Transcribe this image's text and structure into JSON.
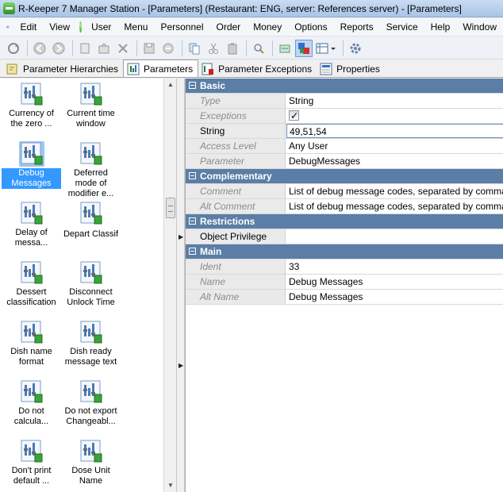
{
  "window": {
    "title": "R-Keeper 7 Manager Station - [Parameters] (Restaurant: ENG, server: References server) - [Parameters]"
  },
  "menu": [
    "Edit",
    "View",
    "User",
    "Menu",
    "Personnel",
    "Order",
    "Money",
    "Options",
    "Reports",
    "Service",
    "Help",
    "Window"
  ],
  "toolbar": {
    "icons": [
      "refresh-icon",
      "back-icon",
      "forward-icon",
      "new-icon",
      "edit-icon",
      "delete-icon",
      "save-icon",
      "cancel-icon",
      "copy-icon",
      "cut-icon",
      "paste-icon",
      "search-icon",
      "filter-icon",
      "color-icon",
      "view-mode-icon",
      "settings-icon"
    ]
  },
  "tabs": [
    {
      "label": "Parameter Hierarchies",
      "selected": false
    },
    {
      "label": "Parameters",
      "selected": true
    },
    {
      "label": "Parameter Exceptions",
      "selected": false
    },
    {
      "label": "Properties",
      "selected": false
    }
  ],
  "icon_list": [
    {
      "label": "Currency of the zero ...",
      "selected": false
    },
    {
      "label": "Current time window",
      "selected": false
    },
    {
      "label": "Debug Messages",
      "selected": true
    },
    {
      "label": "Deferred mode of modifier e...",
      "selected": false
    },
    {
      "label": "Delay of messa...",
      "selected": false
    },
    {
      "label": "Depart Classif",
      "selected": false
    },
    {
      "label": "Dessert classification",
      "selected": false
    },
    {
      "label": "Disconnect Unlock Time",
      "selected": false
    },
    {
      "label": "Dish name format",
      "selected": false
    },
    {
      "label": "Dish ready message text",
      "selected": false
    },
    {
      "label": "Do not calcula...",
      "selected": false
    },
    {
      "label": "Do not export Changeabl...",
      "selected": false
    },
    {
      "label": "Don't print default ...",
      "selected": false
    },
    {
      "label": "Dose Unit Name",
      "selected": false
    }
  ],
  "properties": {
    "basic": {
      "title": "Basic",
      "rows": [
        {
          "name": "Type",
          "value": "String",
          "readonly": true
        },
        {
          "name": "Exceptions",
          "value": "",
          "readonly": true,
          "checkbox": true,
          "checked": true
        },
        {
          "name": "String",
          "value": "49,51,54",
          "readonly": false
        },
        {
          "name": "Access Level",
          "value": "Any User",
          "readonly": true
        },
        {
          "name": "Parameter",
          "value": "DebugMessages",
          "readonly": true
        }
      ]
    },
    "complementary": {
      "title": "Complementary",
      "rows": [
        {
          "name": "Comment",
          "value": "List of debug message codes, separated by commas",
          "readonly": true
        },
        {
          "name": "Alt Comment",
          "value": "List of debug message codes, separated by commas",
          "readonly": true
        }
      ]
    },
    "restrictions": {
      "title": "Restrictions",
      "rows": [
        {
          "name": "Object Privilege",
          "value": "",
          "readonly": false
        }
      ]
    },
    "main": {
      "title": "Main",
      "rows": [
        {
          "name": "Ident",
          "value": "33",
          "readonly": true
        },
        {
          "name": "Name",
          "value": "Debug Messages",
          "readonly": true
        },
        {
          "name": "Alt Name",
          "value": "Debug Messages",
          "readonly": true
        }
      ]
    }
  }
}
